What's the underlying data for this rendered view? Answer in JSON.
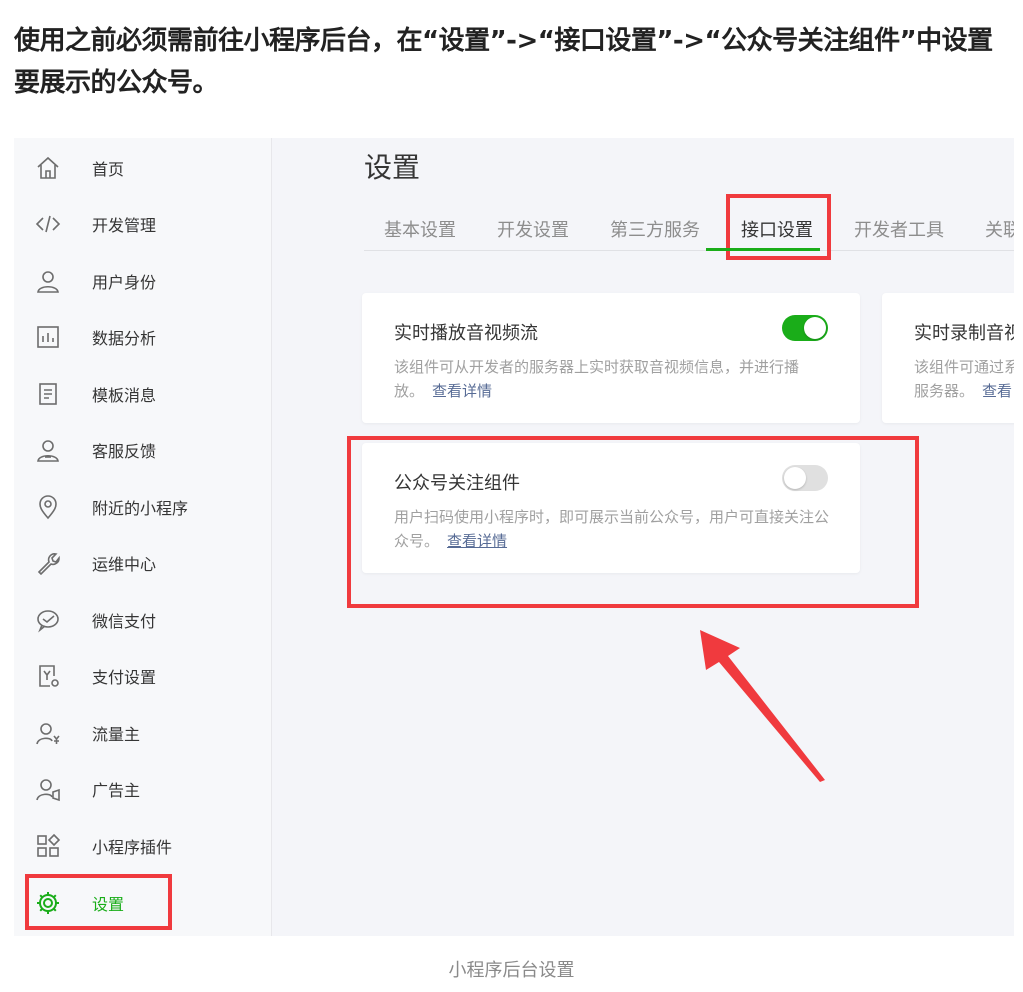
{
  "intro_text": "使用之前必须需前往小程序后台，在“设置”->“接口设置”->“公众号关注组件”中设置要展示的公众号。",
  "sidebar": {
    "items": [
      {
        "label": "首页",
        "icon": "home-icon"
      },
      {
        "label": "开发管理",
        "icon": "code-icon"
      },
      {
        "label": "用户身份",
        "icon": "user-icon"
      },
      {
        "label": "数据分析",
        "icon": "bar-chart-icon"
      },
      {
        "label": "模板消息",
        "icon": "document-icon"
      },
      {
        "label": "客服反馈",
        "icon": "support-user-icon"
      },
      {
        "label": "附近的小程序",
        "icon": "location-pin-icon"
      },
      {
        "label": "运维中心",
        "icon": "wrench-icon"
      },
      {
        "label": "微信支付",
        "icon": "wechat-pay-icon"
      },
      {
        "label": "支付设置",
        "icon": "payment-settings-icon"
      },
      {
        "label": "流量主",
        "icon": "traffic-owner-icon"
      },
      {
        "label": "广告主",
        "icon": "advertiser-icon"
      },
      {
        "label": "小程序插件",
        "icon": "plugin-grid-icon"
      },
      {
        "label": "设置",
        "icon": "gear-icon"
      }
    ],
    "active_index": 13
  },
  "main": {
    "title": "设置",
    "tabs": [
      "基本设置",
      "开发设置",
      "第三方服务",
      "接口设置",
      "开发者工具",
      "关联"
    ],
    "active_tab": "接口设置",
    "cards": [
      {
        "title": "实时播放音视频流",
        "desc": "该组件可从开发者的服务器上实时获取音视频信息，并进行播放。",
        "link": "查看详情",
        "enabled": true
      },
      {
        "title": "实时录制音视",
        "desc_line1": "该组件可通过系",
        "desc_line2": "服务器。",
        "link": "查看"
      },
      {
        "title": "公众号关注组件",
        "desc": "用户扫码使用小程序时，即可展示当前公众号，用户可直接关注公众号。",
        "link": "查看详情",
        "enabled": false
      }
    ]
  },
  "caption": "小程序后台设置",
  "colors": {
    "accent_green": "#1aad19",
    "highlight_red": "#f03a3e",
    "link_blue": "#576b95"
  }
}
